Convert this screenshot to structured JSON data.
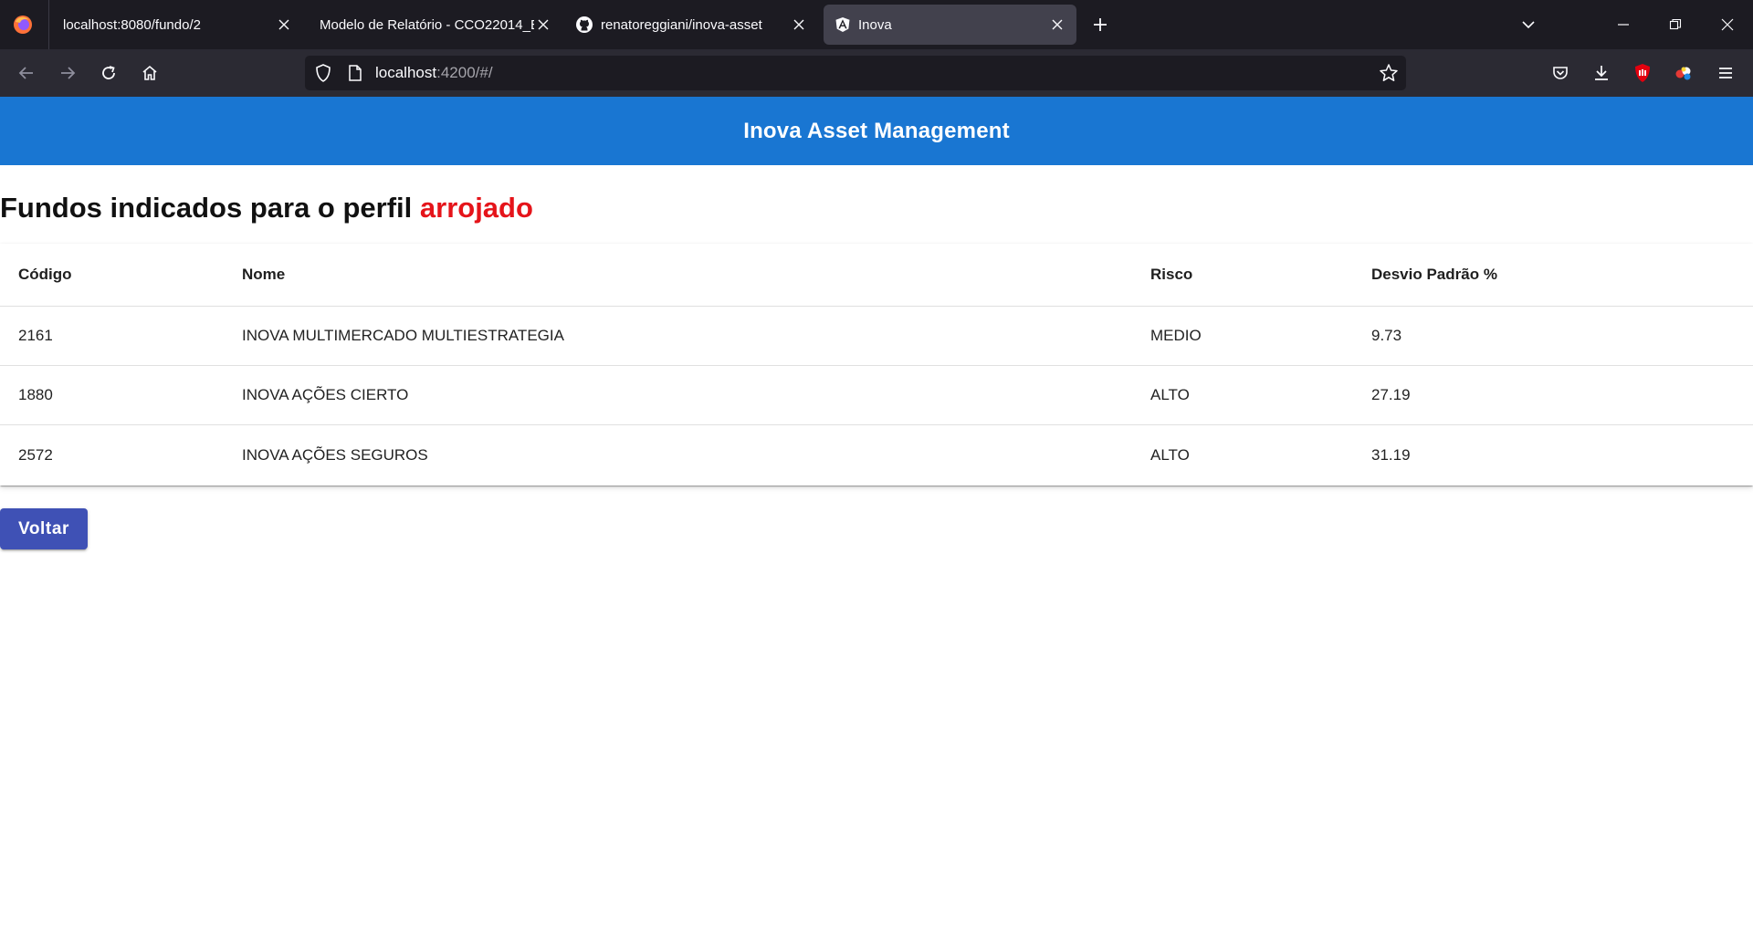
{
  "browser": {
    "tabs": [
      {
        "title": "localhost:8080/fundo/2",
        "active": false
      },
      {
        "title": "Modelo de Relatório - CCO22014_E",
        "active": false
      },
      {
        "title": "renatoreggiani/inova-asset",
        "active": false
      },
      {
        "title": "Inova",
        "active": true
      }
    ],
    "url_host": "localhost",
    "url_rest": ":4200/#/"
  },
  "app": {
    "title": "Inova Asset Management",
    "heading_prefix": "Fundos indicados para o perfil ",
    "profile": "arrojado",
    "profile_color": "#e5141a",
    "toolbar_color": "#1976d2"
  },
  "table": {
    "headers": [
      "Código",
      "Nome",
      "Risco",
      "Desvio Padrão %"
    ],
    "rows": [
      [
        "2161",
        "INOVA MULTIMERCADO MULTIESTRATEGIA",
        "MEDIO",
        "9.73"
      ],
      [
        "1880",
        "INOVA AÇÕES CIERTO",
        "ALTO",
        "27.19"
      ],
      [
        "2572",
        "INOVA AÇÕES SEGUROS",
        "ALTO",
        "31.19"
      ]
    ]
  },
  "actions": {
    "back_label": "Voltar",
    "button_color": "#3f51b5"
  }
}
